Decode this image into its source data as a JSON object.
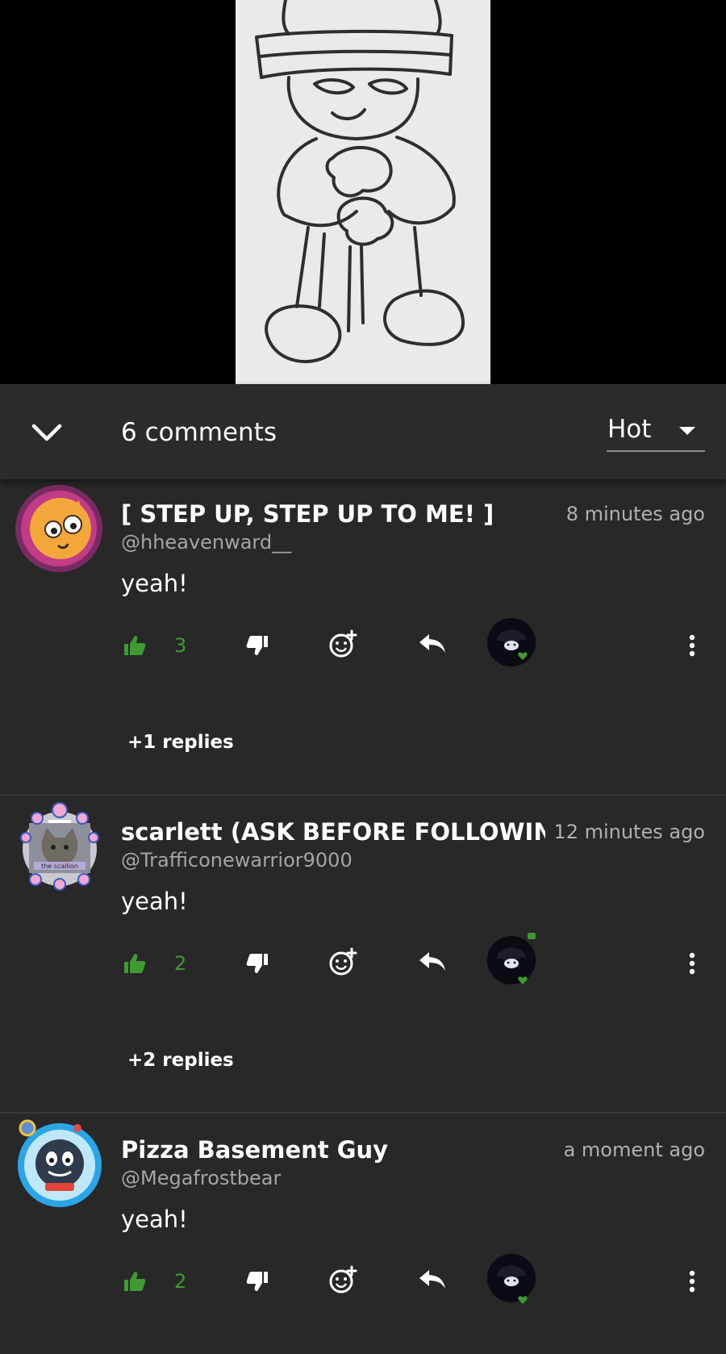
{
  "header": {
    "comment_count": "6 comments",
    "sort_label": "Hot"
  },
  "comments": [
    {
      "name": "[ STEP UP, STEP UP TO ME! ]",
      "handle": "@hheavenward__",
      "time": "8 minutes ago",
      "text": "yeah!",
      "likes": "3",
      "replies": "+1 replies"
    },
    {
      "name": "scarlett (ASK BEFORE FOLLOWING",
      "handle": "@Trafficonewarrior9000",
      "time": "12 minutes ago",
      "text": "yeah!",
      "likes": "2",
      "replies": "+2 replies"
    },
    {
      "name": "Pizza Basement Guy",
      "handle": "@Megafrostbear",
      "time": "a moment ago",
      "text": "yeah!",
      "likes": "2"
    }
  ],
  "avatar_badge_text": "the scallion",
  "colors": {
    "accent_green": "#3f9a31",
    "sheet_bg": "#282828",
    "header_bg": "#2b2b2b",
    "muted_text": "#a5a5a5"
  },
  "icons": {
    "collapse": "chevron-down-icon",
    "like": "thumbs-up-icon",
    "dislike": "thumbs-down-icon",
    "gift": "gift-emoji-icon",
    "reply": "reply-arrow-icon",
    "more": "more-vertical-icon",
    "sort": "caret-down-icon"
  }
}
